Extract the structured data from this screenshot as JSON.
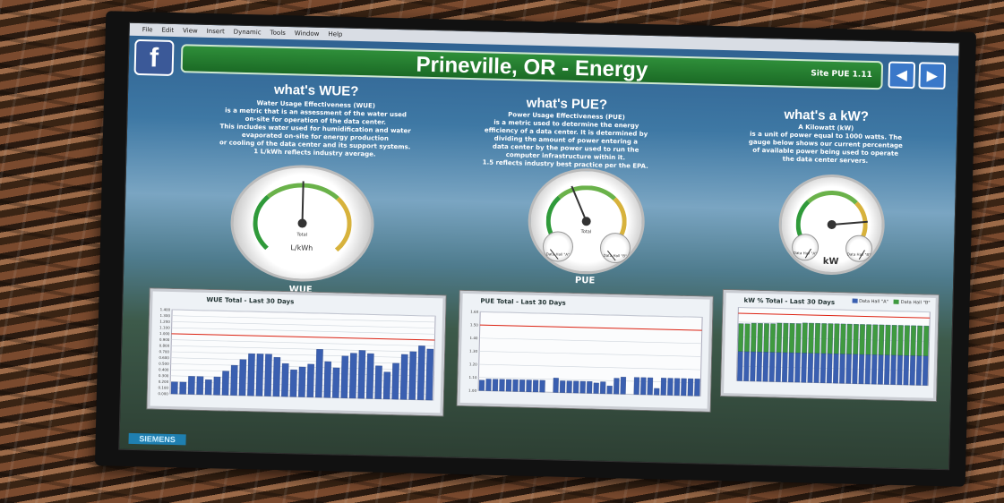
{
  "menu": [
    "File",
    "Edit",
    "View",
    "Insert",
    "Dynamic",
    "Tools",
    "Window",
    "Help"
  ],
  "logo": {
    "letter": "f"
  },
  "header": {
    "title": "Prineville, OR - Energy",
    "site_pue": "Site PUE 1.11"
  },
  "nav": {
    "prev_icon": "◀",
    "next_icon": "▶"
  },
  "sections": {
    "wue": {
      "heading": "what's WUE?",
      "lines": [
        "Water Usage Effectiveness (WUE)",
        "is a metric that is an assessment of the water used",
        "on-site for operation of the data center.",
        "This includes water used for humidification and water",
        "evaporated on-site for energy production",
        "or cooling of the data center and its support systems.",
        "1 L/kWh reflects industry average."
      ]
    },
    "pue": {
      "heading": "what's PUE?",
      "lines": [
        "Power Usage Effectiveness (PUE)",
        "is a metric used to determine the energy",
        "efficiency of a data center. It is determined by",
        "dividing the amount of power entering a",
        "data center by the power used to run the",
        "computer infrastructure within it.",
        "1.5 reflects industry best practice per the EPA."
      ]
    },
    "kw": {
      "heading": "what's a kW?",
      "lines": [
        "A Kilowatt (kW)",
        "is a unit of power equal to 1000 watts. The",
        "gauge below shows our current percentage",
        "of available power being used to operate",
        "the data center servers."
      ]
    }
  },
  "gauges": {
    "wue": {
      "unit": "L/kWh",
      "sub": "Total",
      "name": "WUE",
      "value_fraction": 0.5
    },
    "pue": {
      "sub": "Total",
      "name": "PUE",
      "value_fraction": 0.4,
      "mini_left": "Data Hall \"A\"",
      "mini_right": "Data Hall \"B\""
    },
    "kw": {
      "name": "kW",
      "value_fraction": 0.85,
      "mini_left": "Data Hall \"A\"",
      "mini_right": "Data Hall \"B\""
    }
  },
  "chart_data": [
    {
      "type": "bar",
      "title": "WUE Total - Last 30 Days",
      "ylim": [
        0,
        1.4
      ],
      "yticks": [
        "0.000",
        "0.100",
        "0.200",
        "0.300",
        "0.400",
        "0.500",
        "0.600",
        "0.700",
        "0.800",
        "0.900",
        "1.000",
        "1.100",
        "1.200",
        "1.300",
        "1.400"
      ],
      "reference": 1.0,
      "values": [
        0.2,
        0.2,
        0.3,
        0.3,
        0.25,
        0.3,
        0.4,
        0.5,
        0.6,
        0.7,
        0.7,
        0.7,
        0.65,
        0.55,
        0.45,
        0.5,
        0.55,
        0.8,
        0.6,
        0.5,
        0.7,
        0.75,
        0.8,
        0.75,
        0.55,
        0.45,
        0.6,
        0.75,
        0.8,
        0.9,
        0.85
      ],
      "grid": true
    },
    {
      "type": "bar",
      "title": "PUE Total - Last 30 Days",
      "ylim": [
        1.0,
        1.6
      ],
      "yticks": [
        "1.00",
        "1.10",
        "1.20",
        "1.30",
        "1.40",
        "1.50",
        "1.60"
      ],
      "reference": 1.5,
      "values": [
        1.08,
        1.09,
        1.09,
        1.09,
        1.09,
        1.09,
        1.09,
        1.09,
        1.09,
        1.09,
        1.0,
        1.11,
        1.09,
        1.09,
        1.09,
        1.09,
        1.09,
        1.08,
        1.09,
        1.06,
        1.12,
        1.13,
        1.0,
        1.13,
        1.13,
        1.13,
        1.05,
        1.13,
        1.13,
        1.13,
        1.13,
        1.13,
        1.13
      ],
      "grid": true
    },
    {
      "type": "bar",
      "title": "kW % Total - Last 30 Days",
      "ylim": [
        0,
        100
      ],
      "reference": 92,
      "legend": [
        "Data Hall \"A\"",
        "Data Hall \"B\""
      ],
      "series": [
        {
          "name": "Data Hall \"A\"",
          "color": "#3a5fb0",
          "values": [
            40,
            40,
            40,
            40,
            40,
            40,
            40,
            40,
            40,
            40,
            40,
            40,
            40,
            40,
            40,
            40,
            40,
            40,
            40,
            40,
            40,
            40,
            40,
            40,
            40,
            40,
            40,
            40,
            40,
            40
          ]
        },
        {
          "name": "Data Hall \"B\"",
          "color": "#3f9a3f",
          "values": [
            38,
            38,
            39,
            39,
            39,
            39,
            40,
            40,
            40,
            40,
            41,
            41,
            41,
            41,
            41,
            41,
            41,
            41,
            41,
            41,
            41,
            41,
            41,
            41,
            41,
            41,
            41,
            41,
            41,
            41
          ]
        }
      ],
      "grid": true
    }
  ],
  "footer": {
    "brand": "SIEMENS"
  }
}
